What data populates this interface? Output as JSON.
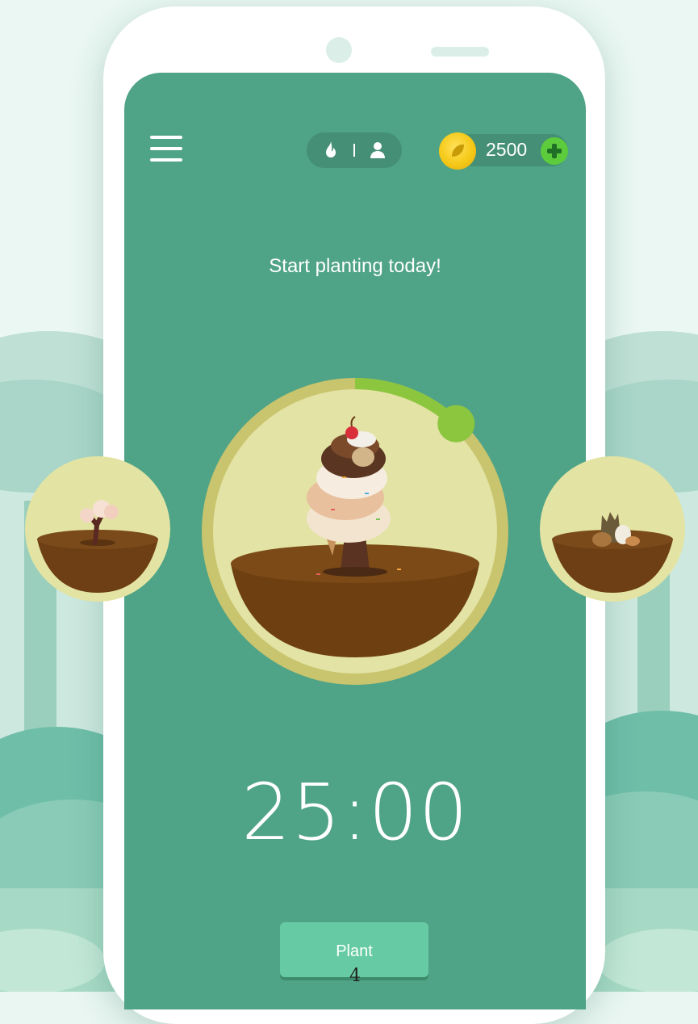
{
  "header": {
    "menu_icon": "hamburger-icon",
    "mode_icons": [
      "flame-icon",
      "person-icon"
    ],
    "coins": "2500",
    "coin_icon": "coin-icon",
    "add_icon": "plus-icon"
  },
  "main": {
    "headline": "Start planting today!",
    "timer": "25:00",
    "progress_fraction": 0.12,
    "plant_button": "Plant"
  },
  "carousel": {
    "left_tree": "cherry-blossom-tree",
    "center_tree": "ice-cream-tree",
    "right_tree": "withered-tree"
  },
  "page_number": "4",
  "colors": {
    "screen": "#4fa386",
    "progress": "#8cc63f",
    "ring": "#c9c46e",
    "button": "#66cba5"
  }
}
